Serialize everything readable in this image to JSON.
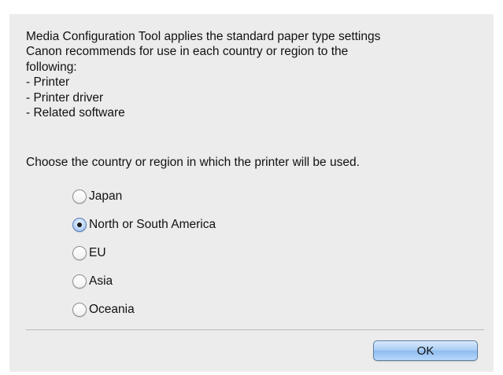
{
  "dialog": {
    "intro_lines": [
      "Media Configuration Tool applies the standard paper type settings",
      "Canon recommends for use in each country or region to the",
      "following:",
      "- Printer",
      "- Printer driver",
      "- Related software"
    ],
    "prompt": "Choose the country or region in which the printer will be used.",
    "regions": [
      {
        "label": "Japan",
        "selected": false
      },
      {
        "label": "North or South America",
        "selected": true
      },
      {
        "label": "EU",
        "selected": false
      },
      {
        "label": "Asia",
        "selected": false
      },
      {
        "label": "Oceania",
        "selected": false
      }
    ],
    "ok_label": "OK"
  },
  "colors": {
    "dialog_background": "#ececec",
    "button_accent": "#a9cdf4",
    "separator": "#b9b9b9"
  },
  "icons": {
    "radio_unselected": "radio-button-empty-icon",
    "radio_selected": "radio-button-selected-icon"
  }
}
